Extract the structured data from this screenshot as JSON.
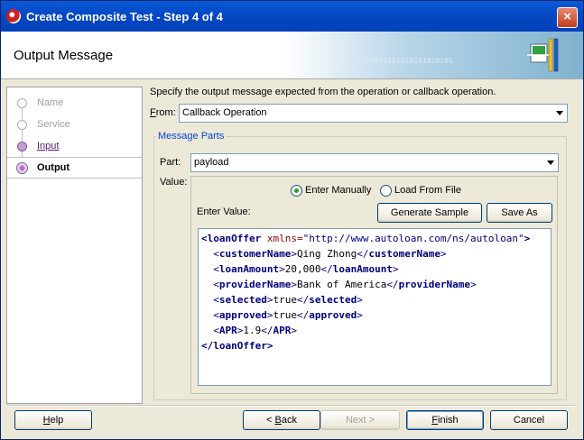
{
  "window": {
    "title": "Create Composite Test - Step 4 of 4",
    "close_label": "×"
  },
  "banner": {
    "heading": "Output Message",
    "binary_text": "010101010101010101010101"
  },
  "steps": [
    {
      "label": "Name",
      "state": "pending"
    },
    {
      "label": "Service",
      "state": "pending"
    },
    {
      "label": "Input",
      "state": "done"
    },
    {
      "label": "Output",
      "state": "current"
    }
  ],
  "main": {
    "description": "Specify the output message expected from the operation or callback operation.",
    "from_label_accel": "F",
    "from_label_rest": "rom:",
    "from_value": "Callback Operation",
    "group_title": "Message Parts",
    "part_label": "Part:",
    "part_value": "payload",
    "value_label": "Value:",
    "radio_manual": "Enter Manually",
    "radio_file": "Load From File",
    "enter_value_label": "Enter Value:",
    "generate_sample_label": "Generate Sample",
    "save_as_label": "Save As"
  },
  "xml": {
    "root_open_tag": "<loanOffer",
    "root_attr_name": " xmlns=",
    "root_attr_value": "\"http://www.autoloan.com/ns/autoloan\"",
    "root_open_close": ">",
    "root_close": "</loanOffer>",
    "children": [
      {
        "name": "customerName",
        "value": "Qing Zhong"
      },
      {
        "name": "loanAmount",
        "value": "20,000"
      },
      {
        "name": "providerName",
        "value": "Bank of America"
      },
      {
        "name": "selected",
        "value": "true"
      },
      {
        "name": "approved",
        "value": "true"
      },
      {
        "name": "APR",
        "value": "1.9"
      }
    ]
  },
  "footer": {
    "help_accel": "H",
    "help_rest": "elp",
    "back_prefix": "< ",
    "back_accel": "B",
    "back_rest": "ack",
    "next_label": "Next >",
    "finish_accel": "F",
    "finish_rest": "inish",
    "cancel_label": "Cancel"
  }
}
